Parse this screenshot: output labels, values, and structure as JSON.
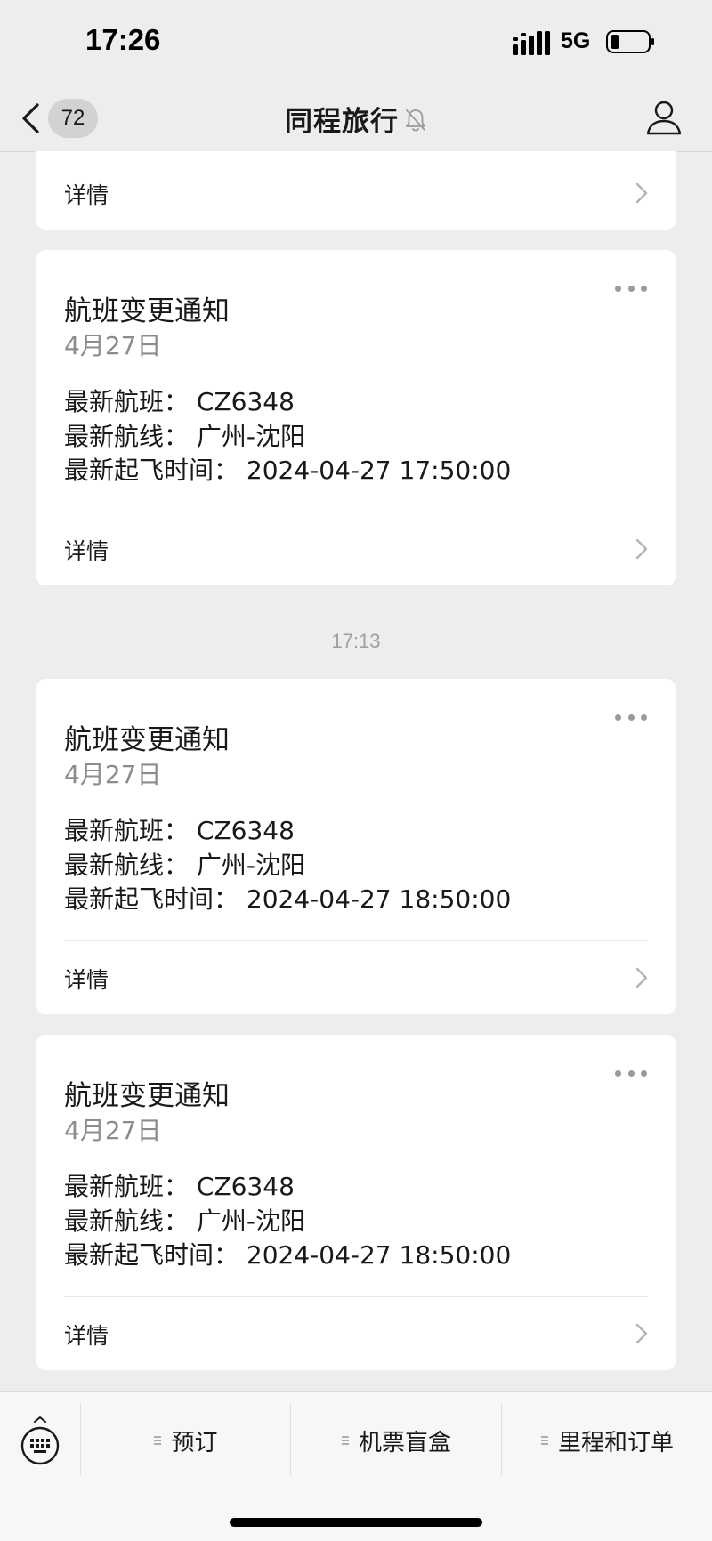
{
  "status_bar": {
    "time": "17:26",
    "network": "5G"
  },
  "nav": {
    "unread_count": "72",
    "title": "同程旅行"
  },
  "partial_card": {
    "detail_label": "详情"
  },
  "cards_top": [
    {
      "title": "航班变更通知",
      "date": "4月27日",
      "flight": "最新航班：  CZ6348",
      "route": "最新航线：  广州-沈阳",
      "departure": "最新起飞时间：  2024-04-27 17:50:00",
      "detail_label": "详情"
    }
  ],
  "timestamp": "17:13",
  "cards_bottom": [
    {
      "title": "航班变更通知",
      "date": "4月27日",
      "flight": "最新航班：  CZ6348",
      "route": "最新航线：  广州-沈阳",
      "departure": "最新起飞时间：  2024-04-27 18:50:00",
      "detail_label": "详情"
    },
    {
      "title": "航班变更通知",
      "date": "4月27日",
      "flight": "最新航班：  CZ6348",
      "route": "最新航线：  广州-沈阳",
      "departure": "最新起飞时间：  2024-04-27 18:50:00",
      "detail_label": "详情"
    }
  ],
  "menu": [
    {
      "label": "预订"
    },
    {
      "label": "机票盲盒"
    },
    {
      "label": "里程和订单"
    }
  ],
  "icons": {
    "back": "chevron-left-icon",
    "mute": "bell-off-icon",
    "profile": "person-icon",
    "more": "more-dots-icon",
    "chevron": "chevron-right-icon",
    "keyboard": "keyboard-icon",
    "menu": "menu-lines-icon"
  },
  "colors": {
    "background": "#ededed",
    "card": "#ffffff",
    "text": "#191919",
    "secondary_text": "#8c8c8c",
    "badge": "#d2d2d2"
  }
}
